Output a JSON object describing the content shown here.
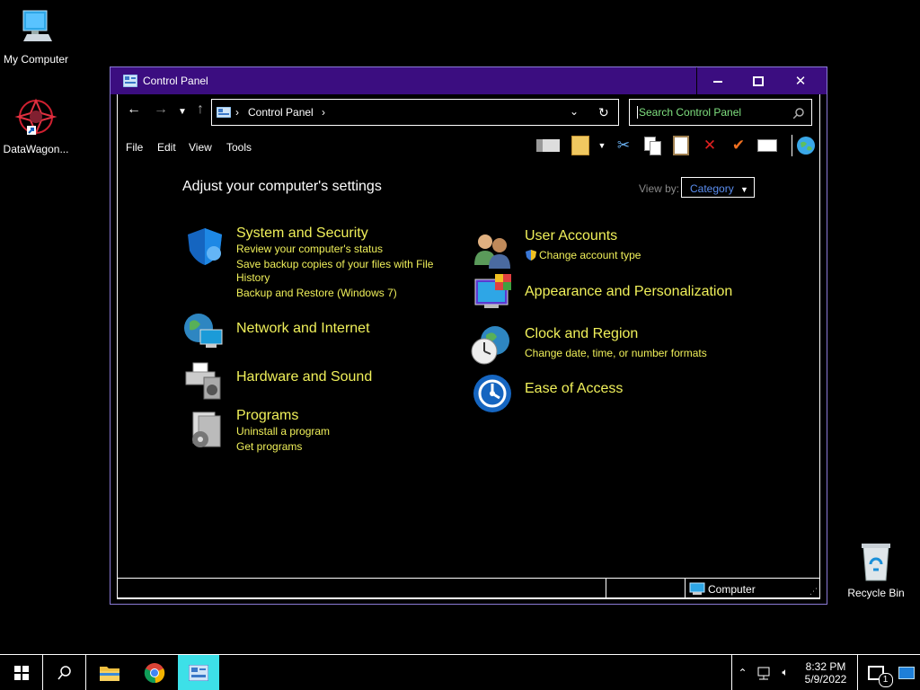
{
  "desktop": {
    "icons": [
      {
        "label": "My Computer",
        "icon": "computer-icon"
      },
      {
        "label": "DataWagon...",
        "icon": "datawagon-shortcut-icon"
      },
      {
        "label": "Recycle Bin",
        "icon": "recycle-bin-icon"
      }
    ]
  },
  "window": {
    "title": "Control Panel",
    "address": {
      "path": "Control Panel"
    },
    "search": {
      "placeholder": "Search Control Panel"
    },
    "menu": [
      "File",
      "Edit",
      "View",
      "Tools"
    ],
    "heading": "Adjust your computer's settings",
    "view_by": {
      "label": "View by:",
      "value": "Category"
    },
    "categories": {
      "left": [
        {
          "title": "System and Security",
          "links": [
            "Review your computer's status",
            "Save backup copies of your files with File History",
            "Backup and Restore (Windows 7)"
          ]
        },
        {
          "title": "Network and Internet",
          "links": []
        },
        {
          "title": "Hardware and Sound",
          "links": []
        },
        {
          "title": "Programs",
          "links": [
            "Uninstall a program",
            "Get programs"
          ]
        }
      ],
      "right": [
        {
          "title": "User Accounts",
          "links": [
            "Change account type"
          ]
        },
        {
          "title": "Appearance and Personalization",
          "links": []
        },
        {
          "title": "Clock and Region",
          "links": [
            "Change date, time, or number formats"
          ]
        },
        {
          "title": "Ease of Access",
          "links": []
        }
      ]
    },
    "status": {
      "location": "Computer"
    }
  },
  "taskbar": {
    "time": "8:32 PM",
    "date": "5/9/2022",
    "notification_count": "1"
  },
  "colors": {
    "titlebar": "#3b0d80",
    "link": "#f0f05a",
    "search_text": "#7fe07f",
    "category_select": "#5b8ef0"
  }
}
